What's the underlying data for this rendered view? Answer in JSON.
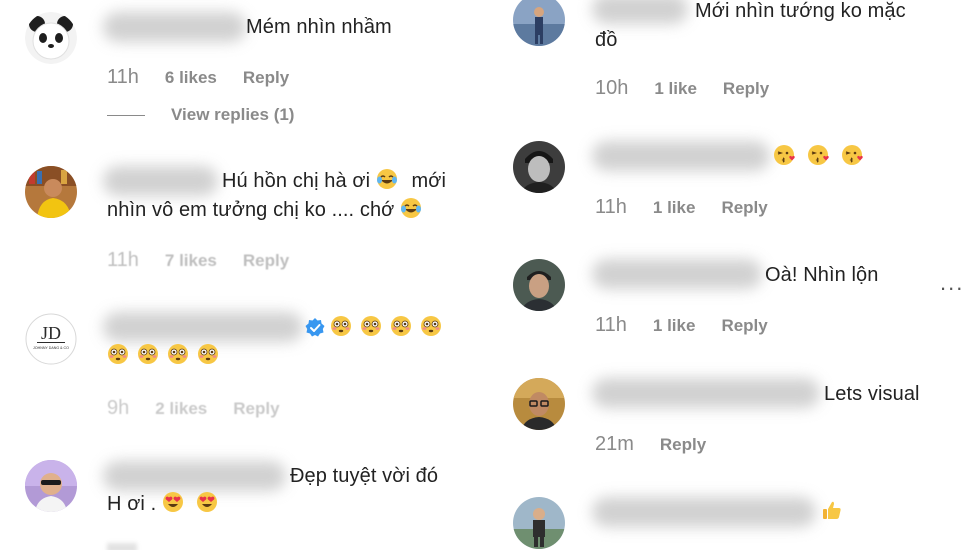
{
  "left_column": [
    {
      "id": "c1",
      "text": "Mém nhìn nhầm",
      "time": "11h",
      "likes": "6 likes",
      "reply": "Reply",
      "view_replies": "View replies (1)",
      "avatar": "panda-avatar"
    },
    {
      "id": "c2",
      "text_line1": "Hú hồn chị hà ơi",
      "text_line1_tail": "mới",
      "text_line2": "nhìn vô em tưởng chị ko .... chớ",
      "emoji": "tears-of-joy",
      "time": "11h",
      "likes": "7 likes",
      "reply": "Reply",
      "avatar": "person-yellow-avatar"
    },
    {
      "id": "c3",
      "emoji": "flushed-face",
      "emoji_count": 8,
      "time": "9h",
      "likes": "2 likes",
      "reply": "Reply",
      "avatar": "logo-avatar",
      "avatar_logo_text": "JOHNNY DANG & CO",
      "verified": true
    },
    {
      "id": "c4",
      "text_line1": "Đẹp tuyệt vời đó",
      "text_line2": "H ơi .",
      "emoji": "heart-eyes",
      "avatar": "person-sunglasses-avatar"
    }
  ],
  "right_column": [
    {
      "id": "r1",
      "text_line1": "Mới nhìn tướng ko mặc",
      "text_line2": "đồ",
      "time": "10h",
      "likes": "1 like",
      "reply": "Reply",
      "avatar": "person-standing-avatar"
    },
    {
      "id": "r2",
      "emoji": "kissing-heart",
      "emoji_count": 3,
      "time": "11h",
      "likes": "1 like",
      "reply": "Reply",
      "avatar": "man-bw-avatar"
    },
    {
      "id": "r3",
      "text": "Oà! Nhìn lộn",
      "time": "11h",
      "likes": "1 like",
      "reply": "Reply",
      "avatar": "man-dark-avatar",
      "more": "..."
    },
    {
      "id": "r4",
      "text": "Lets visual",
      "time": "21m",
      "reply": "Reply",
      "avatar": "man-glasses-avatar"
    },
    {
      "id": "r5",
      "emoji": "thumbs-up",
      "avatar": "person-outdoor-avatar"
    }
  ],
  "colors": {
    "text": "#222222",
    "meta": "#8a8a8a",
    "verified": "#3897f0",
    "background": "#ffffff"
  }
}
